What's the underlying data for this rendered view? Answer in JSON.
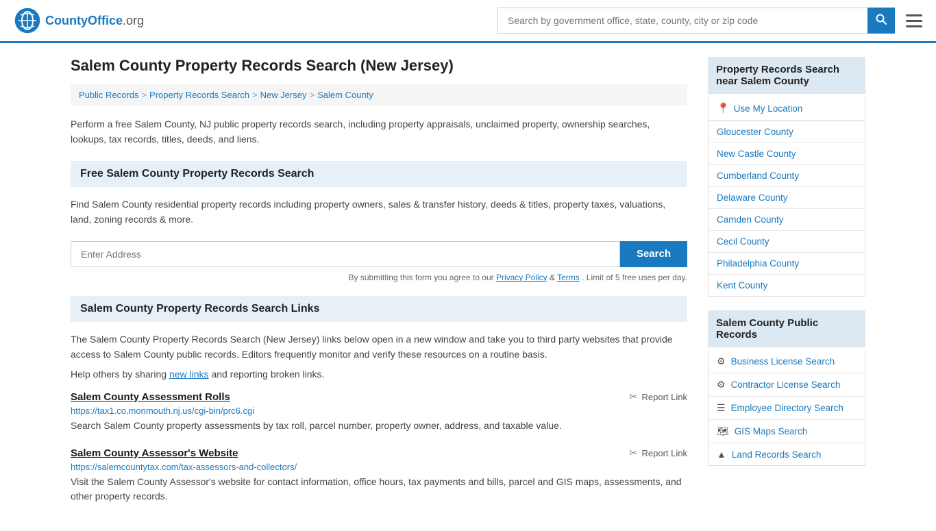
{
  "header": {
    "logo_text": "CountyOffice",
    "logo_tld": ".org",
    "search_placeholder": "Search by government office, state, county, city or zip code"
  },
  "page": {
    "title": "Salem County Property Records Search (New Jersey)",
    "description": "Perform a free Salem County, NJ public property records search, including property appraisals, unclaimed property, ownership searches, lookups, tax records, titles, deeds, and liens.",
    "breadcrumbs": [
      {
        "label": "Public Records",
        "href": "#"
      },
      {
        "label": "Property Records Search",
        "href": "#"
      },
      {
        "label": "New Jersey",
        "href": "#"
      },
      {
        "label": "Salem County",
        "href": "#"
      }
    ]
  },
  "free_search": {
    "heading": "Free Salem County Property Records Search",
    "description": "Find Salem County residential property records including property owners, sales & transfer history, deeds & titles, property taxes, valuations, land, zoning records & more.",
    "address_placeholder": "Enter Address",
    "search_button": "Search",
    "form_notice": "By submitting this form you agree to our",
    "privacy_label": "Privacy Policy",
    "terms_label": "Terms",
    "limit_notice": ". Limit of 5 free uses per day."
  },
  "links_section": {
    "heading": "Salem County Property Records Search Links",
    "description": "The Salem County Property Records Search (New Jersey) links below open in a new window and take you to third party websites that provide access to Salem County public records. Editors frequently monitor and verify these resources on a routine basis.",
    "share_text": "Help others by sharing",
    "share_link_label": "new links",
    "share_suffix": "and reporting broken links.",
    "links": [
      {
        "title": "Salem County Assessment Rolls",
        "url": "https://tax1.co.monmouth.nj.us/cgi-bin/prc6.cgi",
        "description": "Search Salem County property assessments by tax roll, parcel number, property owner, address, and taxable value.",
        "report_label": "Report Link"
      },
      {
        "title": "Salem County Assessor's Website",
        "url": "https://salemcountytax.com/tax-assessors-and-collectors/",
        "description": "Visit the Salem County Assessor's website for contact information, office hours, tax payments and bills, parcel and GIS maps, assessments, and other property records.",
        "report_label": "Report Link"
      }
    ]
  },
  "sidebar": {
    "nearby_heading": "Property Records Search near Salem County",
    "use_my_location": "Use My Location",
    "nearby_counties": [
      {
        "label": "Gloucester County"
      },
      {
        "label": "New Castle County"
      },
      {
        "label": "Cumberland County"
      },
      {
        "label": "Delaware County"
      },
      {
        "label": "Camden County"
      },
      {
        "label": "Cecil County"
      },
      {
        "label": "Philadelphia County"
      },
      {
        "label": "Kent County"
      }
    ],
    "public_records_heading": "Salem County Public Records",
    "public_records": [
      {
        "label": "Business License Search",
        "icon": "⚙"
      },
      {
        "label": "Contractor License Search",
        "icon": "⚙"
      },
      {
        "label": "Employee Directory Search",
        "icon": "☰"
      },
      {
        "label": "GIS Maps Search",
        "icon": "🗺"
      },
      {
        "label": "Land Records Search",
        "icon": "▲"
      }
    ]
  }
}
